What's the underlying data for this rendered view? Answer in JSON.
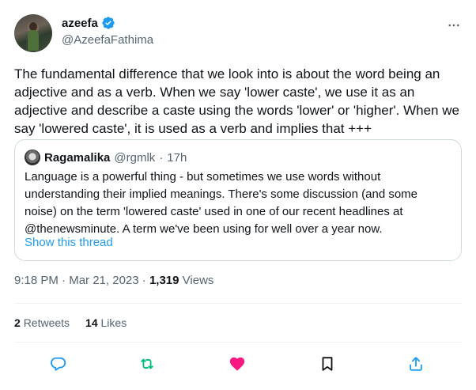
{
  "author": {
    "display_name": "azeefa",
    "handle": "@AzeefaFathima",
    "verified": true,
    "verified_color": "#1d9bf0"
  },
  "more_icon": "more-options-icon",
  "tweet_text": "The fundamental difference that we look into is about the word being an adjective and as a verb. When we say 'lower caste', we use it as an adjective and describe a caste using the words 'lower' or 'higher'. When we say 'lowered caste', it is used as a verb and implies that +++",
  "quote": {
    "display_name": "Ragamalika",
    "handle": "@rgmlk",
    "separator": "·",
    "time": "17h",
    "text": "Language is a powerful thing - but sometimes we use words without understanding their implied meanings. There's some discussion (and some noise) on the term 'lowered caste' used in one of our recent headlines at @thenewsminute. A term we've been using for well over a year now.",
    "show_thread": "Show this thread",
    "link_color": "#1d9bf0"
  },
  "meta": {
    "time": "9:18 PM",
    "dot1": "·",
    "date": "Mar 21, 2023",
    "dot2": "·",
    "views_count": "1,319",
    "views_label": "Views"
  },
  "stats": {
    "retweets_count": "2",
    "retweets_label": "Retweets",
    "likes_count": "14",
    "likes_label": "Likes"
  },
  "actions": [
    {
      "icon": "reply-icon",
      "color": "#1d9bf0"
    },
    {
      "icon": "retweet-icon",
      "color": "#00ba7c"
    },
    {
      "icon": "like-heart-icon",
      "color": "#f91880"
    },
    {
      "icon": "bookmark-icon",
      "color": "#0f1419"
    },
    {
      "icon": "share-icon",
      "color": "#1d9bf0"
    }
  ]
}
